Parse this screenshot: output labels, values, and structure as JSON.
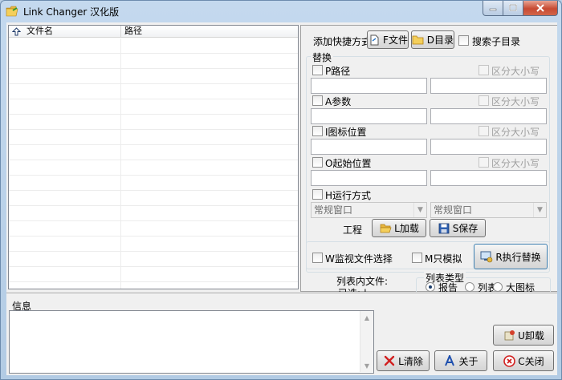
{
  "window": {
    "title": "Link Changer 汉化版"
  },
  "list": {
    "columns": [
      "文件名",
      "路径"
    ]
  },
  "shortcut": {
    "label": "添加快捷方式",
    "file_button": "F文件",
    "dir_button": "D目录",
    "search_subdirs": "搜索子目录"
  },
  "replace": {
    "title": "替换",
    "case_label": "区分大小写",
    "rows": [
      {
        "label": "P路径"
      },
      {
        "label": "A参数"
      },
      {
        "label": "I图标位置"
      },
      {
        "label": "O起始位置"
      }
    ],
    "run_mode": {
      "label": "H运行方式",
      "from_value": "常规窗口",
      "to_value": "常规窗口"
    }
  },
  "project": {
    "label": "工程",
    "load_button": "L加载",
    "save_button": "S保存"
  },
  "actions": {
    "monitor_label": "W监视文件选择",
    "simulate_label": "M只模拟",
    "execute_button": "R执行替换"
  },
  "status": {
    "files_in_list": "列表内文件:",
    "selected": "已选: |"
  },
  "list_type": {
    "title": "列表类型",
    "options": [
      "报告",
      "列表",
      "大图标"
    ],
    "selected": "报告"
  },
  "info": {
    "label": "信息"
  },
  "buttons": {
    "uninstall": "U卸载",
    "clear": "L清除",
    "about": "关于",
    "close": "C关闭"
  }
}
